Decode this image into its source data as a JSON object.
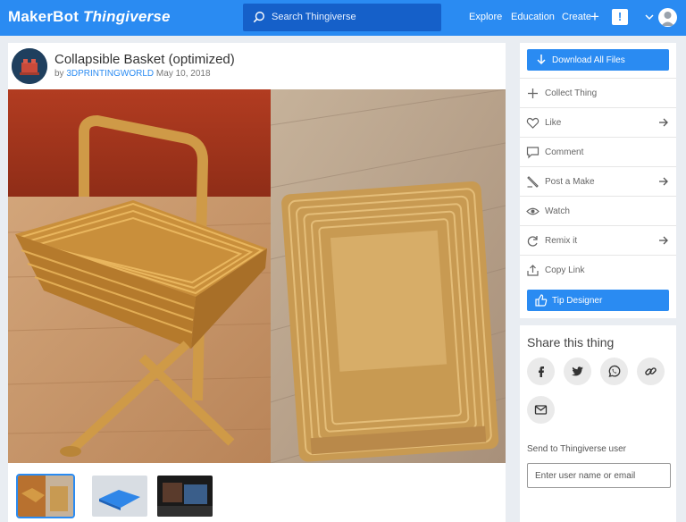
{
  "header": {
    "logo_makerbot": "MakerBot",
    "logo_thingiverse": "Thingiverse",
    "search_placeholder": "Search Thingiverse",
    "nav": {
      "explore": "Explore",
      "education": "Education",
      "create": "Create"
    },
    "plus_glyph": "+",
    "alert_glyph": "!"
  },
  "thing": {
    "title": "Collapsible Basket (optimized)",
    "by_prefix": "by",
    "author": "3DPRINTINGWORLD",
    "date": "May 10, 2018"
  },
  "actions": {
    "download": "Download All Files",
    "collect": "Collect Thing",
    "like": "Like",
    "comment": "Comment",
    "post_make": "Post a Make",
    "watch": "Watch",
    "remix": "Remix it",
    "copy_link": "Copy Link",
    "tip": "Tip Designer"
  },
  "share": {
    "title": "Share this thing",
    "icons": [
      "facebook-icon",
      "twitter-icon",
      "whatsapp-icon",
      "link-icon",
      "email-icon"
    ],
    "send_label": "Send to Thingiverse user",
    "send_placeholder": "Enter user name or email"
  },
  "colors": {
    "brand": "#2a8bf2",
    "search_bg": "#1560c9",
    "page_bg": "#e9edf2"
  }
}
